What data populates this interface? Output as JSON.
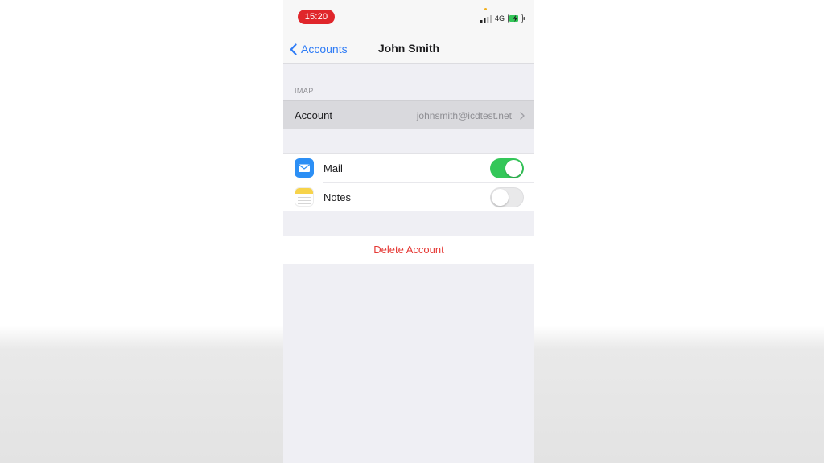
{
  "status_bar": {
    "time": "15:20",
    "network": "4G",
    "time_pill_color": "#e0262b",
    "signal_icon": "cellular-signal-icon",
    "battery_icon": "battery-charging-icon"
  },
  "nav": {
    "back_label": "Accounts",
    "back_icon": "chevron-left-icon",
    "title": "John Smith",
    "accent_color": "#2f7cf6"
  },
  "imap_section": {
    "header": "IMAP",
    "account_label": "Account",
    "account_value": "johnsmith@icdtest.net",
    "chevron_icon": "chevron-right-icon"
  },
  "apps": [
    {
      "label": "Mail",
      "icon": "mail-app-icon",
      "enabled": true
    },
    {
      "label": "Notes",
      "icon": "notes-app-icon",
      "enabled": false
    }
  ],
  "toggle_on_color": "#34c759",
  "delete": {
    "label": "Delete Account",
    "color": "#e53935"
  }
}
